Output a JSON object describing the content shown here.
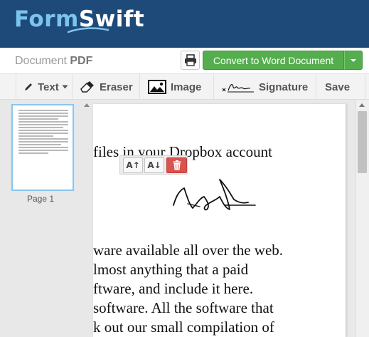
{
  "header": {
    "logo_part1": "Form",
    "logo_part2": "Swift"
  },
  "titlebar": {
    "doc_label": "Document",
    "doc_type": "PDF",
    "print_icon": "printer-icon",
    "convert_label": "Convert to Word Document",
    "convert_dropdown_icon": "caret-down-icon"
  },
  "toolbar": {
    "text_label": "Text",
    "text_icons": [
      "pencil-icon",
      "caret-down-icon"
    ],
    "eraser_label": "Eraser",
    "eraser_icon": "eraser-icon",
    "image_label": "Image",
    "image_icon": "image-icon",
    "signature_label": "Signature",
    "signature_icon": "signature-icon",
    "save_label": "Save"
  },
  "sidebar": {
    "pages": [
      {
        "label": "Page 1"
      }
    ]
  },
  "document": {
    "lines": [
      "files in your Dropbox account",
      "ware available all over the web.",
      "lmost anything that a paid",
      "ftware, and include it here.",
      "software. All the software that",
      "k out our small compilation of"
    ]
  },
  "text_controls": {
    "increase_label": "A↑",
    "decrease_label": "A↓",
    "delete_icon": "trash-icon"
  },
  "colors": {
    "header_bg": "#1e4a7a",
    "logo_accent": "#7cc4ee",
    "convert_green": "#55ae4e",
    "delete_red": "#d9534f"
  }
}
